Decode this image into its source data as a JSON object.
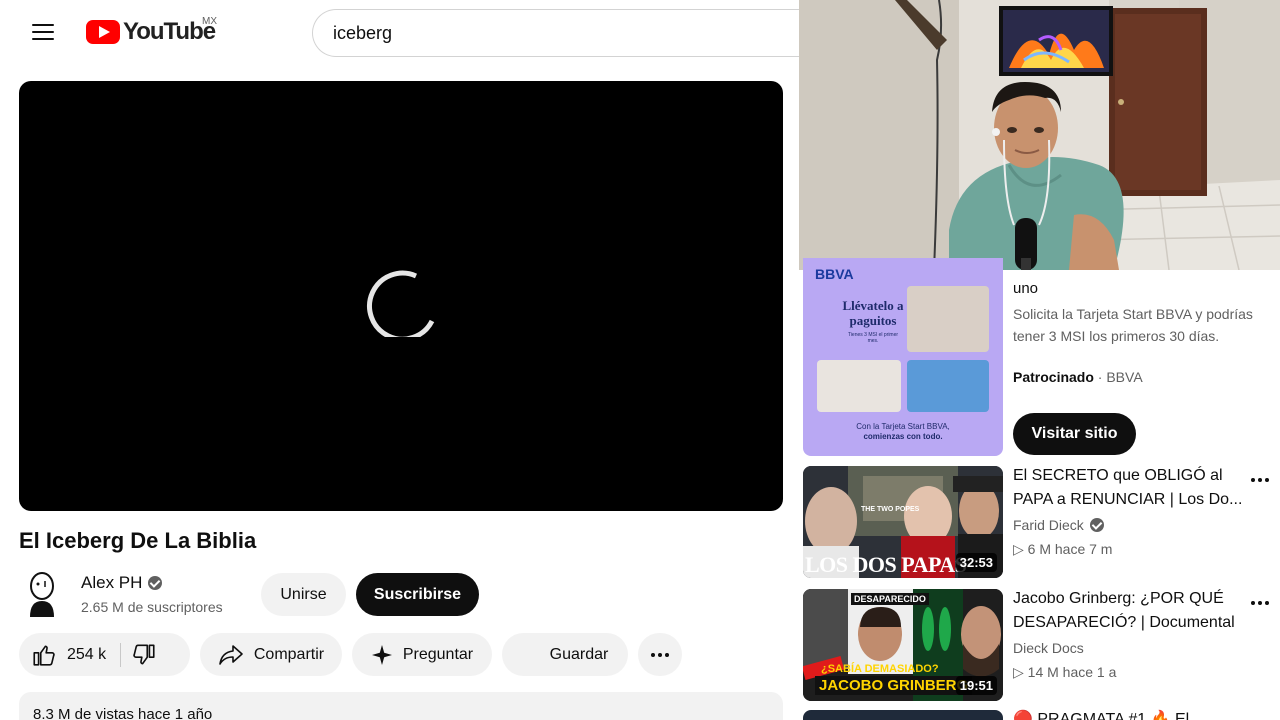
{
  "header": {
    "logo_text": "YouTube",
    "region": "MX",
    "search_value": "iceberg"
  },
  "video": {
    "title": "El Iceberg De La Biblia",
    "channel": "Alex PH",
    "subscribers": "2.65 M de suscriptores",
    "join_label": "Unirse",
    "subscribe_label": "Suscribirse",
    "likes": "254 k",
    "share_label": "Compartir",
    "ask_label": "Preguntar",
    "save_label": "Guardar",
    "description_preview": "8.3 M de vistas  hace 1 año"
  },
  "ad": {
    "logo": "BBVA",
    "slogan": "Llévatelo a paguitos",
    "small_print": "Tienes 3 MSI el primer mes.",
    "footer_line1": "Con la Tarjeta Start BBVA,",
    "footer_line2": "comienzas con todo.",
    "title": "uno",
    "description": "Solicita la Tarjeta Start BBVA y podrías tener 3 MSI los primeros 30 días.",
    "sponsored": "Patrocinado",
    "advertiser": "· BBVA",
    "cta": "Visitar sitio"
  },
  "recommendations": [
    {
      "title": "El SECRETO que OBLIGÓ al PAPA a RENUNCIAR | Los Do...",
      "channel": "Farid Dieck",
      "meta": "▷ 6 M   hace 7 m",
      "duration": "32:53",
      "thumb_caption": "LOS DOS PAPAS",
      "thumb_small": "THE TWO POPES"
    },
    {
      "title": "Jacobo Grinberg: ¿POR QUÉ DESAPARECIÓ? | Documental",
      "channel": "Dieck Docs",
      "meta": "▷ 14 M   hace 1 a",
      "duration": "19:51",
      "thumb_caption": "JACOBO GRINBERG",
      "thumb_small": "¿SABÍA DEMASIADO?",
      "thumb_label": "DESAPARECIDO"
    }
  ],
  "next_partial_title": "🔴 PRAGMATA #1 🔥 El"
}
